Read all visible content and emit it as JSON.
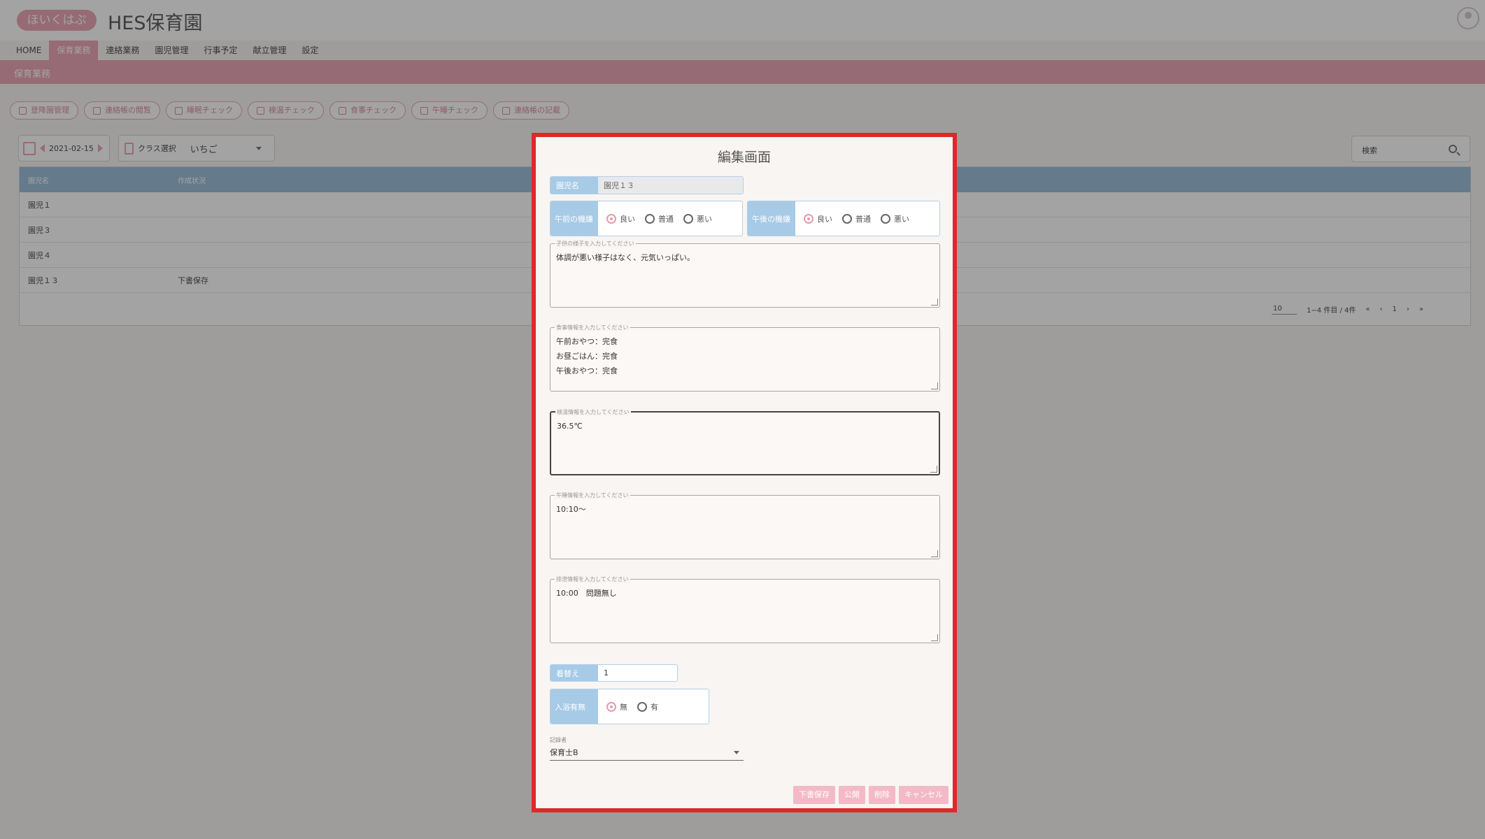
{
  "header": {
    "logo_text": "ほいくはぷ",
    "title": "HES保育園"
  },
  "nav": [
    "HOME",
    "保育業務",
    "連絡業務",
    "園児管理",
    "行事予定",
    "献立管理",
    "設定"
  ],
  "section_title": "保育業務",
  "actions": [
    "登降園管理",
    "連絡帳の閲覧",
    "睡眠チェック",
    "検温チェック",
    "食事チェック",
    "午睡チェック",
    "連絡帳の記載"
  ],
  "filters": {
    "date": "2021-02-15",
    "class_label": "クラス選択",
    "class_value": "いちご",
    "search_placeholder": "検索"
  },
  "table": {
    "headers": [
      "園児名",
      "作成状況"
    ],
    "rows": [
      [
        "園児１",
        ""
      ],
      [
        "園児３",
        ""
      ],
      [
        "園児４",
        ""
      ],
      [
        "園児１３",
        "下書保存"
      ]
    ],
    "per_page": "10",
    "range": "1−4 件目 / 4件",
    "page": "1"
  },
  "dialog": {
    "title": "編集画面",
    "name_label": "園児名",
    "name_value": "園児１３",
    "am_mood_label": "午前の機嫌",
    "pm_mood_label": "午後の機嫌",
    "mood_options": [
      "良い",
      "普通",
      "悪い"
    ],
    "child_label": "子供の様子を入力してください",
    "child_text": "体調が悪い様子はなく、元気いっぱい。",
    "meal_label": "食事情報を入力してください",
    "meal_text": "午前おやつ：完食\nお昼ごはん：完食\n午後おやつ：完食",
    "temp_label": "検温情報を入力してください",
    "temp_text": "36.5℃",
    "nap_label": "午睡情報を入力してください",
    "nap_text": "10:10〜",
    "excretion_label": "排泄情報を入力してください",
    "excretion_text": "10:00　問題無し",
    "change_label": "着替え",
    "change_value": "1",
    "bath_label": "入浴有無",
    "bath_options": [
      "無",
      "有"
    ],
    "recorder_label": "記録者",
    "recorder_value": "保育士B",
    "buttons": [
      "下書保存",
      "公開",
      "削除",
      "キャンセル"
    ]
  }
}
